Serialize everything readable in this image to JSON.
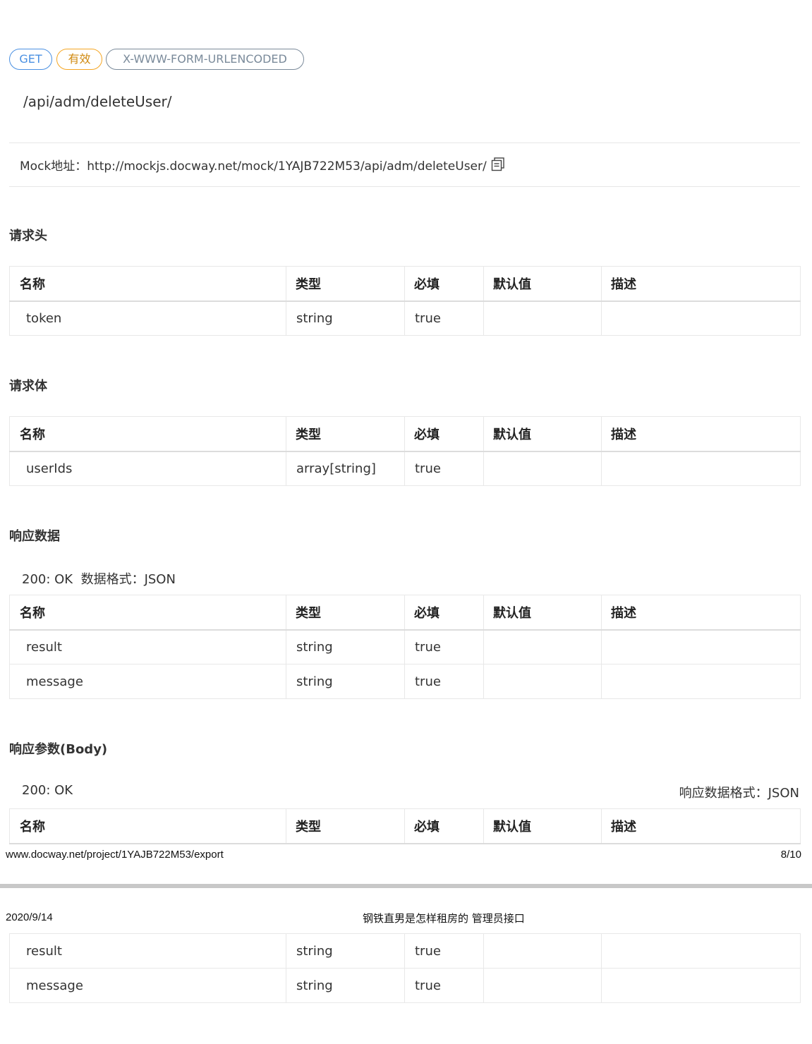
{
  "tags": {
    "method": "GET",
    "status": "有效",
    "content_type": "X-WWW-FORM-URLENCODED"
  },
  "colors": {
    "method_tag": "#4a90e2",
    "status_tag": "#f5a623",
    "content_type_tag": "#7a8a9a"
  },
  "api_path": "/api/adm/deleteUser/",
  "mock": {
    "label": "Mock地址：",
    "url": "http://mockjs.docway.net/mock/1YAJB722M53/api/adm/deleteUser/",
    "icon": "copy-icon"
  },
  "table_headers": [
    "名称",
    "类型",
    "必填",
    "默认值",
    "描述"
  ],
  "request_headers": {
    "title": "请求头",
    "rows": [
      [
        "token",
        "string",
        "true",
        "",
        ""
      ]
    ]
  },
  "request_body": {
    "title": "请求体",
    "rows": [
      [
        "userIds",
        "array[string]",
        "true",
        "",
        ""
      ]
    ]
  },
  "response_data": {
    "title": "响应数据",
    "status": "200: OK",
    "format": "数据格式：JSON",
    "rows": [
      [
        "result",
        "string",
        "true",
        "",
        ""
      ],
      [
        "message",
        "string",
        "true",
        "",
        ""
      ]
    ]
  },
  "response_params": {
    "title": "响应参数(Body)",
    "status": "200: OK",
    "format": "响应数据格式：JSON",
    "rows": [
      [
        "result",
        "string",
        "true",
        "",
        ""
      ],
      [
        "message",
        "string",
        "true",
        "",
        ""
      ]
    ]
  },
  "page_footer": {
    "url": "www.docway.net/project/1YAJB722M53/export",
    "page": "8/10"
  },
  "page_header": {
    "date": "2020/9/14",
    "title": "钢铁直男是怎样租房的 管理员接口"
  }
}
